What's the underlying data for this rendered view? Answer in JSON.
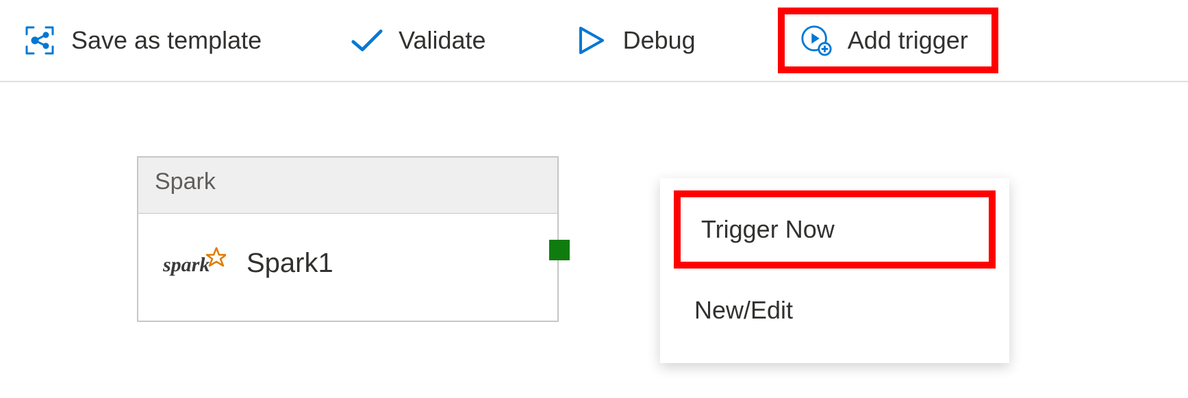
{
  "toolbar": {
    "save_as_template": "Save as template",
    "validate": "Validate",
    "debug": "Debug",
    "add_trigger": "Add trigger"
  },
  "trigger_menu": {
    "trigger_now": "Trigger Now",
    "new_edit": "New/Edit"
  },
  "node": {
    "type_label": "Spark",
    "name": "Spark1"
  }
}
